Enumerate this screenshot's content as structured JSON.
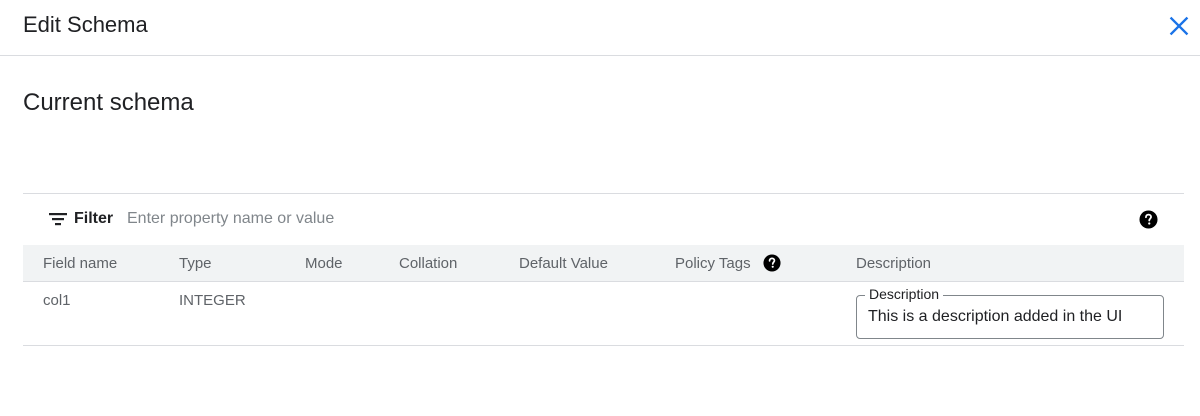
{
  "dialog": {
    "title": "Edit Schema",
    "close_icon": "close-icon"
  },
  "section": {
    "title": "Current schema"
  },
  "filter": {
    "label": "Filter",
    "placeholder": "Enter property name or value",
    "filter_icon": "filter-list-icon",
    "help_icon": "help-icon"
  },
  "table": {
    "columns": {
      "field_name": "Field name",
      "type": "Type",
      "mode": "Mode",
      "collation": "Collation",
      "default_value": "Default Value",
      "policy_tags": "Policy Tags",
      "description": "Description"
    },
    "rows": [
      {
        "field_name": "col1",
        "type": "INTEGER",
        "mode": "",
        "collation": "",
        "default_value": "",
        "policy_tags": "",
        "description_label": "Description",
        "description": "This is a description added in the UI"
      }
    ]
  },
  "colors": {
    "accent": "#1a73e8",
    "header_bg": "#f1f3f4",
    "divider": "#dadce0"
  }
}
